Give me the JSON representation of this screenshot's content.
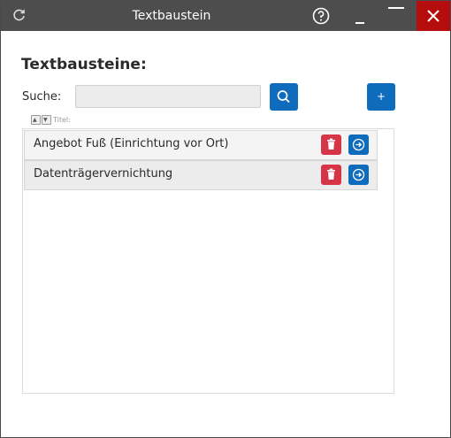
{
  "window": {
    "title": "Textbaustein",
    "refresh_icon": "refresh-icon",
    "help_icon": "help-circle-icon",
    "minimize_icon": "minimize-icon",
    "maximize_icon": "maximize-icon",
    "close_icon": "close-icon"
  },
  "main": {
    "heading": "Textbausteine:",
    "search": {
      "label": "Suche:",
      "value": "",
      "placeholder": "",
      "button_icon": "search-icon"
    },
    "add_button": {
      "label": "+"
    },
    "sort": {
      "label": "Titel:"
    },
    "items": [
      {
        "title": "Angebot Fuß (Einrichtung vor Ort)"
      },
      {
        "title": "Datenträgervernichtung"
      }
    ]
  },
  "colors": {
    "titlebar": "#4d4d4d",
    "close": "#b50d0d",
    "primary": "#0f6cbd",
    "danger": "#d63447"
  }
}
